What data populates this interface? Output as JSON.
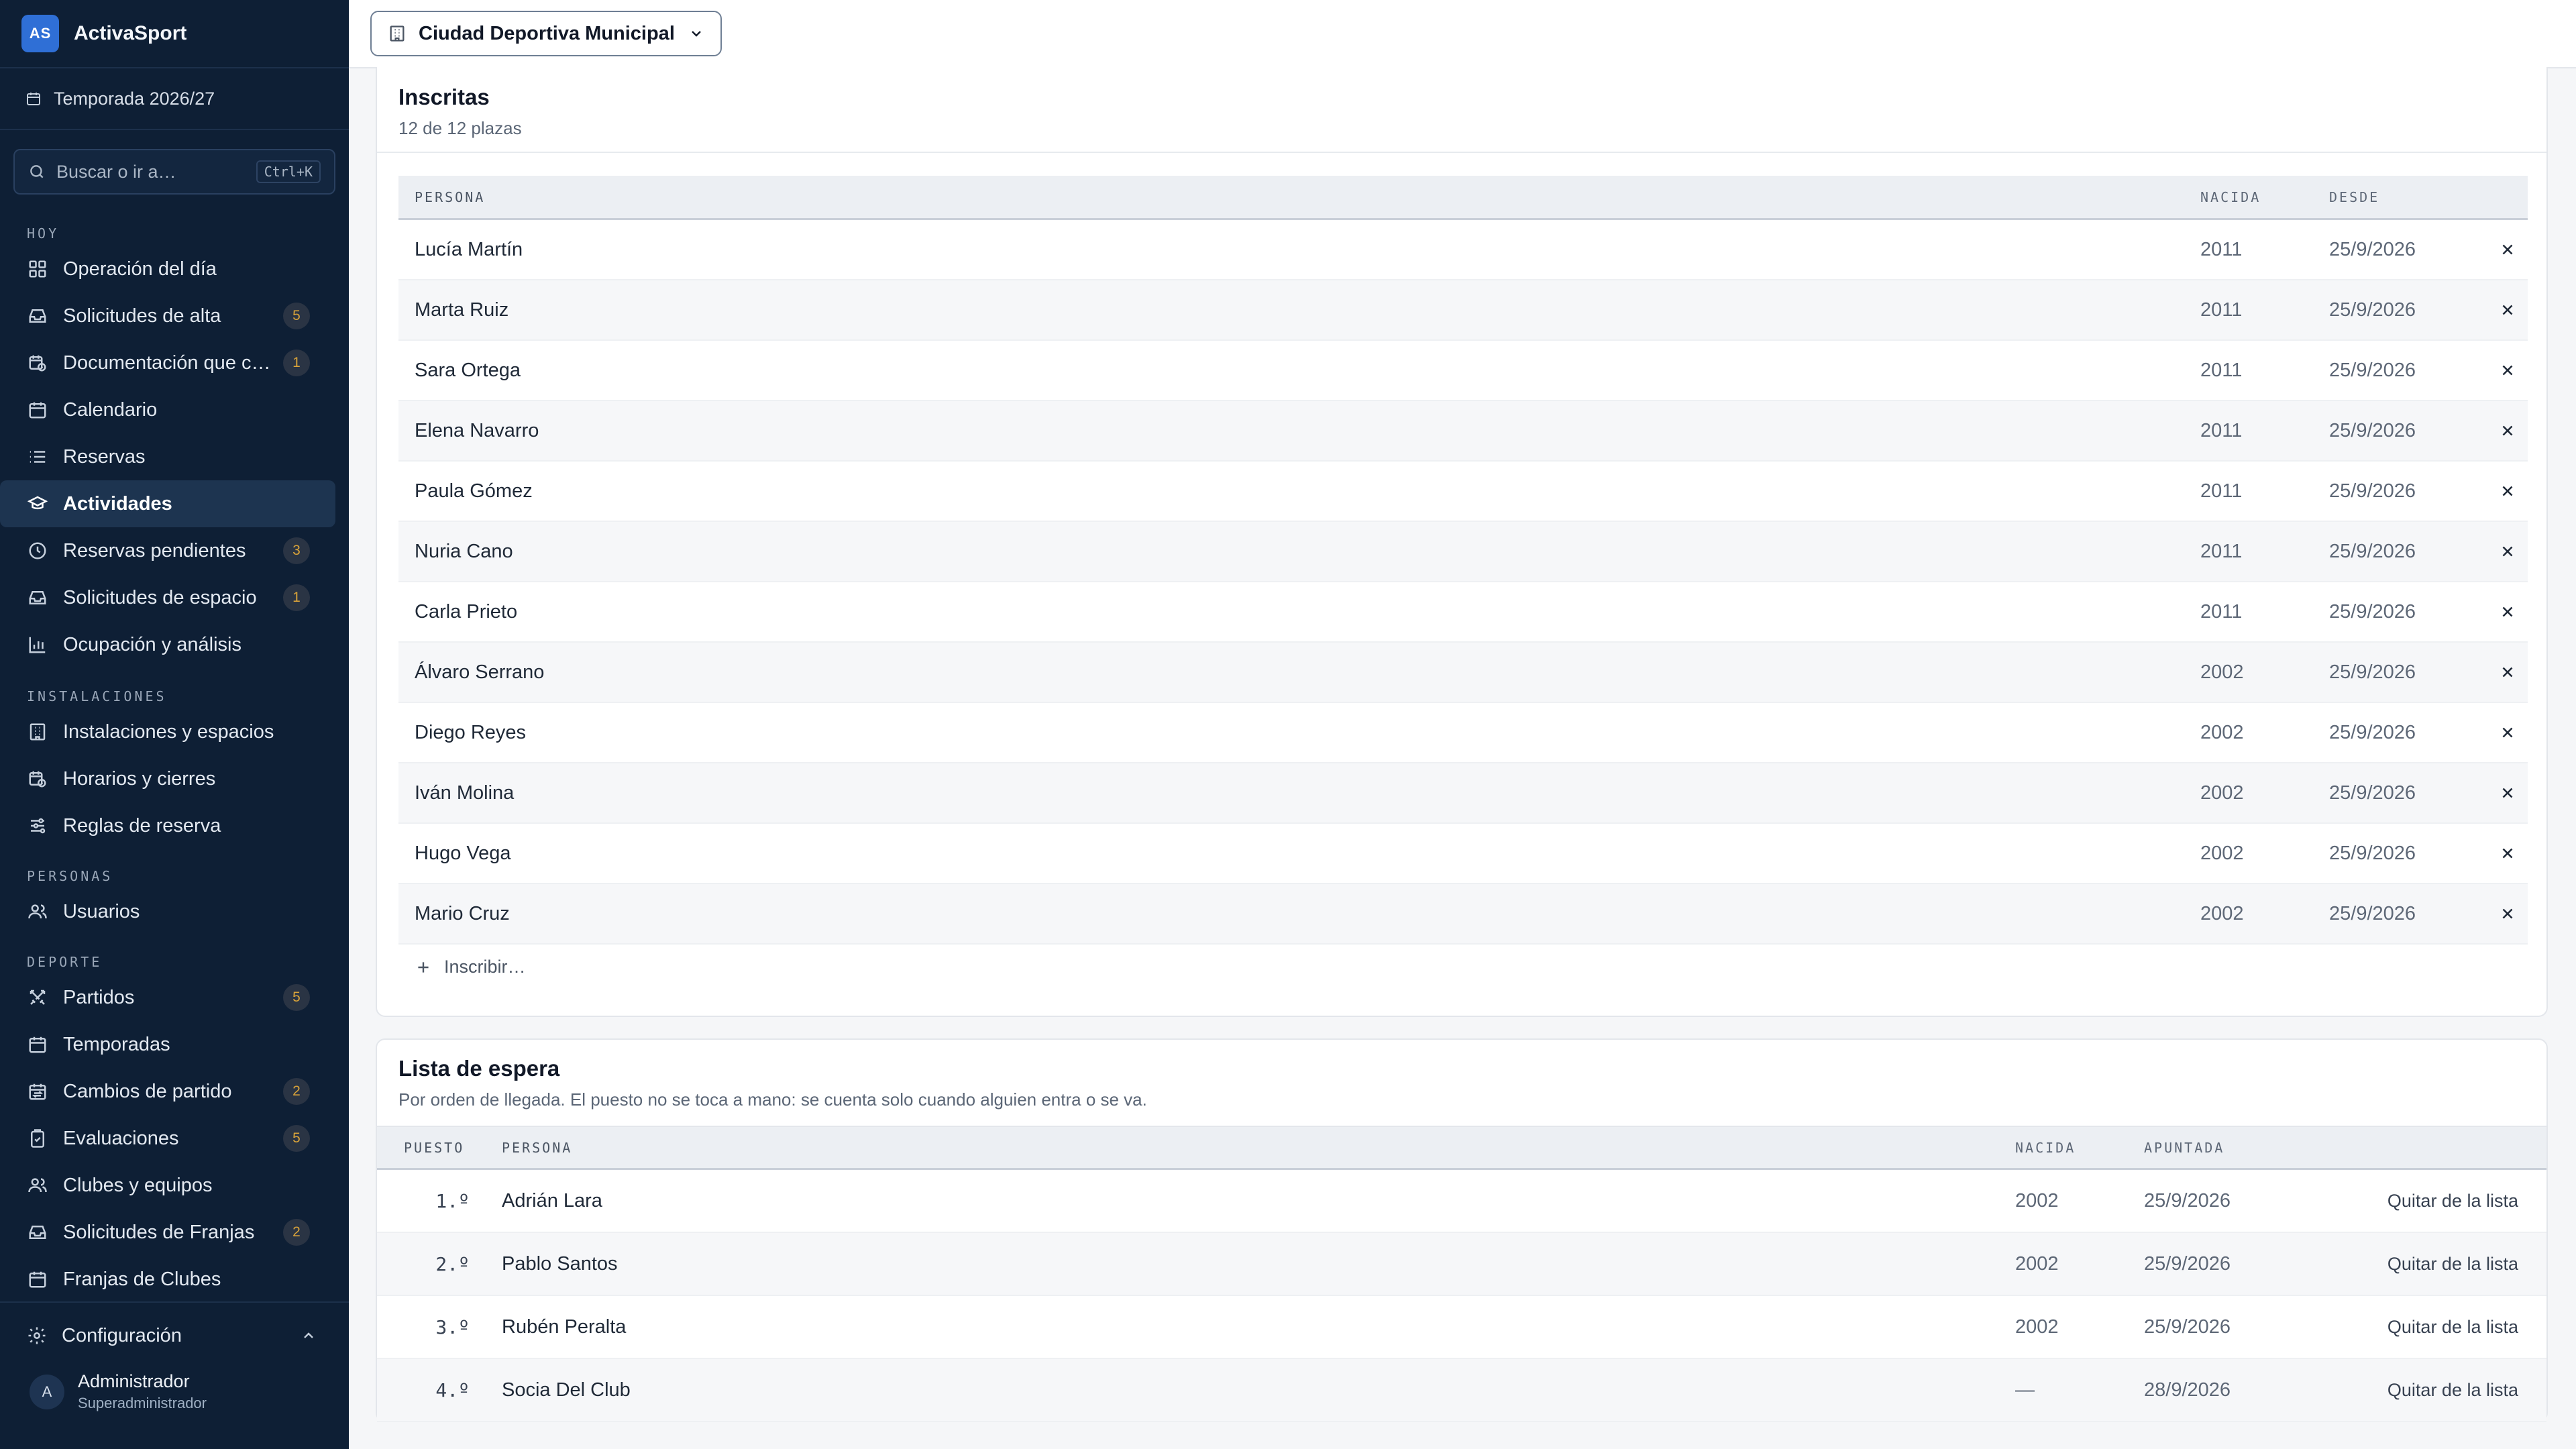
{
  "app": {
    "logo": "AS",
    "name": "ActivaSport"
  },
  "season": {
    "label": "Temporada 2026/27"
  },
  "search": {
    "placeholder": "Buscar o ir a…",
    "shortcut": "Ctrl+K"
  },
  "sidebar": {
    "sections": [
      {
        "label": "HOY",
        "items": [
          {
            "label": "Operación del día",
            "icon": "grid-icon"
          },
          {
            "label": "Solicitudes de alta",
            "icon": "inbox-icon",
            "badge": "5"
          },
          {
            "label": "Documentación que ca…",
            "icon": "calendar-clock-icon",
            "badge": "1"
          },
          {
            "label": "Calendario",
            "icon": "calendar-icon"
          },
          {
            "label": "Reservas",
            "icon": "list-icon"
          },
          {
            "label": "Actividades",
            "icon": "graduation-cap-icon",
            "active": true
          },
          {
            "label": "Reservas pendientes",
            "icon": "clock-icon",
            "badge": "3"
          },
          {
            "label": "Solicitudes de espacio",
            "icon": "inbox-icon",
            "badge": "1"
          },
          {
            "label": "Ocupación y análisis",
            "icon": "bar-chart-icon"
          }
        ]
      },
      {
        "label": "INSTALACIONES",
        "items": [
          {
            "label": "Instalaciones y espacios",
            "icon": "building-icon"
          },
          {
            "label": "Horarios y cierres",
            "icon": "calendar-clock-icon"
          },
          {
            "label": "Reglas de reserva",
            "icon": "sliders-icon"
          }
        ]
      },
      {
        "label": "PERSONAS",
        "items": [
          {
            "label": "Usuarios",
            "icon": "users-icon"
          }
        ]
      },
      {
        "label": "DEPORTE",
        "items": [
          {
            "label": "Partidos",
            "icon": "swords-icon",
            "badge": "5"
          },
          {
            "label": "Temporadas",
            "icon": "calendar-icon"
          },
          {
            "label": "Cambios de partido",
            "icon": "calendar-swap-icon",
            "badge": "2"
          },
          {
            "label": "Evaluaciones",
            "icon": "clipboard-check-icon",
            "badge": "5"
          },
          {
            "label": "Clubes y equipos",
            "icon": "users-icon"
          },
          {
            "label": "Solicitudes de Franjas",
            "icon": "inbox-icon",
            "badge": "2"
          },
          {
            "label": "Franjas de Clubes",
            "icon": "calendar-icon"
          }
        ]
      }
    ],
    "config_label": "Configuración",
    "user": {
      "initial": "A",
      "name": "Administrador",
      "role": "Superadministrador"
    }
  },
  "topbar": {
    "venue": "Ciudad Deportiva Municipal"
  },
  "enrolled": {
    "title": "Inscritas",
    "subtitle": "12 de 12 plazas",
    "columns": {
      "person": "PERSONA",
      "born": "NACIDA",
      "since": "DESDE"
    },
    "rows": [
      {
        "name": "Lucía Martín",
        "born": "2011",
        "since": "25/9/2026"
      },
      {
        "name": "Marta Ruiz",
        "born": "2011",
        "since": "25/9/2026"
      },
      {
        "name": "Sara Ortega",
        "born": "2011",
        "since": "25/9/2026"
      },
      {
        "name": "Elena Navarro",
        "born": "2011",
        "since": "25/9/2026"
      },
      {
        "name": "Paula Gómez",
        "born": "2011",
        "since": "25/9/2026"
      },
      {
        "name": "Nuria Cano",
        "born": "2011",
        "since": "25/9/2026"
      },
      {
        "name": "Carla Prieto",
        "born": "2011",
        "since": "25/9/2026"
      },
      {
        "name": "Álvaro Serrano",
        "born": "2002",
        "since": "25/9/2026"
      },
      {
        "name": "Diego Reyes",
        "born": "2002",
        "since": "25/9/2026"
      },
      {
        "name": "Iván Molina",
        "born": "2002",
        "since": "25/9/2026"
      },
      {
        "name": "Hugo Vega",
        "born": "2002",
        "since": "25/9/2026"
      },
      {
        "name": "Mario Cruz",
        "born": "2002",
        "since": "25/9/2026"
      }
    ],
    "add_label": "Inscribir…"
  },
  "waitlist": {
    "title": "Lista de espera",
    "subtitle": "Por orden de llegada. El puesto no se toca a mano: se cuenta solo cuando alguien entra o se va.",
    "columns": {
      "position": "PUESTO",
      "person": "PERSONA",
      "born": "NACIDA",
      "joined": "APUNTADA"
    },
    "rows": [
      {
        "position": "1.º",
        "name": "Adrián Lara",
        "born": "2002",
        "joined": "25/9/2026",
        "action": "Quitar de la lista"
      },
      {
        "position": "2.º",
        "name": "Pablo Santos",
        "born": "2002",
        "joined": "25/9/2026",
        "action": "Quitar de la lista"
      },
      {
        "position": "3.º",
        "name": "Rubén Peralta",
        "born": "2002",
        "joined": "25/9/2026",
        "action": "Quitar de la lista"
      },
      {
        "position": "4.º",
        "name": "Socia Del Club",
        "born": "—",
        "joined": "28/9/2026",
        "action": "Quitar de la lista"
      }
    ]
  },
  "colors": {
    "sidebar_bg": "#0e1f35",
    "accent": "#2f6fd6",
    "badge_text": "#d9a33a"
  }
}
